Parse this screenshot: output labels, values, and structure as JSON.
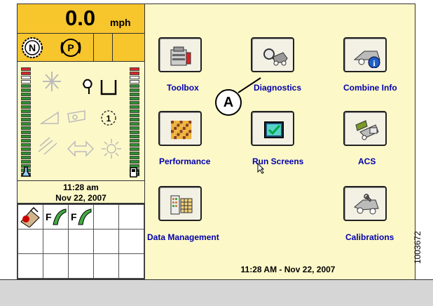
{
  "status": {
    "speed_value": "0.0",
    "speed_unit": "mph",
    "gear_neutral": "N",
    "park_brake": "P",
    "gauge_digit": "1",
    "time": "11:28 am",
    "date": "Nov 22, 2007",
    "fault_tabs": [
      "F",
      "F"
    ]
  },
  "menu": {
    "toolbox": "Toolbox",
    "diagnostics": "Diagnostics",
    "combine_info": "Combine Info",
    "performance": "Performance",
    "run_screens": "Run Screens",
    "acs": "ACS",
    "data_management": "Data Management",
    "calibrations": "Calibrations"
  },
  "footer": {
    "timestamp": "11:28 AM - Nov 22, 2007"
  },
  "callout": {
    "letter": "A"
  },
  "figure_ref": "1003672",
  "colors": {
    "panel_bg": "#fdf8c8",
    "status_yellow": "#f7c52c",
    "label_blue": "#0000aa",
    "bar_green": "#2f8f2f",
    "bar_red": "#d42a2a"
  }
}
